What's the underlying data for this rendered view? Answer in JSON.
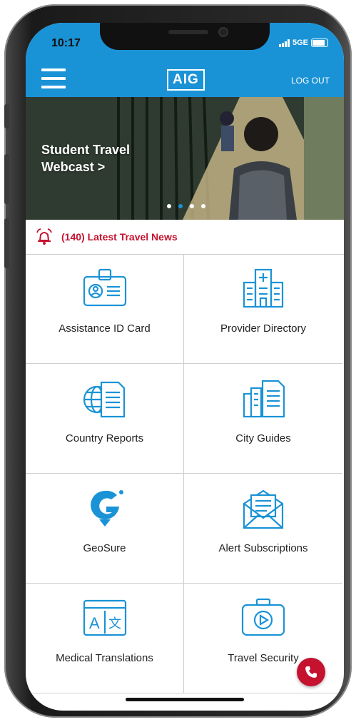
{
  "status_bar": {
    "time": "10:17",
    "network": "5GE"
  },
  "header": {
    "logo": "AIG",
    "logout": "LOG OUT"
  },
  "banner": {
    "title": "Student Travel\nWebcast >",
    "dots": 4,
    "active_dot": 1
  },
  "news": {
    "text": "(140) Latest Travel News"
  },
  "tiles": [
    {
      "label": "Assistance ID Card",
      "icon": "id-card-icon"
    },
    {
      "label": "Provider Directory",
      "icon": "hospital-building-icon"
    },
    {
      "label": "Country Reports",
      "icon": "globe-document-icon"
    },
    {
      "label": "City Guides",
      "icon": "city-document-icon"
    },
    {
      "label": "GeoSure",
      "icon": "geosure-logo-icon"
    },
    {
      "label": "Alert Subscriptions",
      "icon": "envelope-letter-icon"
    },
    {
      "label": "Medical Translations",
      "icon": "translate-icon"
    },
    {
      "label": "Travel Security",
      "icon": "camera-case-icon"
    }
  ],
  "colors": {
    "primary": "#1a93d6",
    "alert_red": "#c4122f"
  }
}
